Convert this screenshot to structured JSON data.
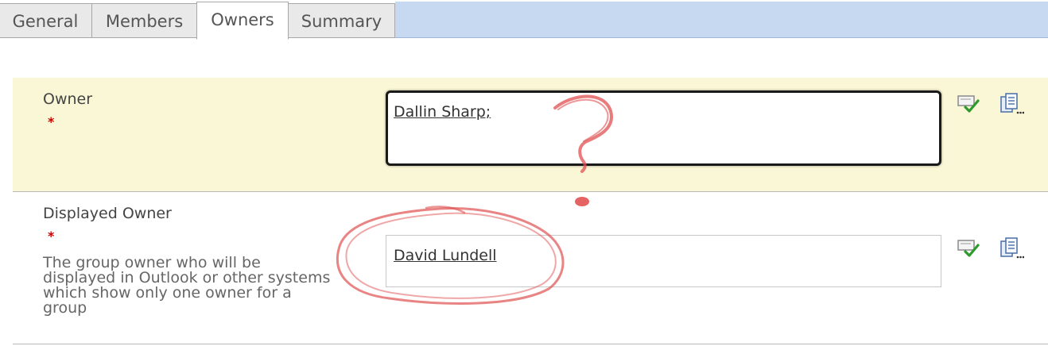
{
  "tabs": [
    {
      "label": "General",
      "active": false
    },
    {
      "label": "Members",
      "active": false
    },
    {
      "label": "Owners",
      "active": true
    },
    {
      "label": "Summary",
      "active": false
    }
  ],
  "fields": {
    "owner": {
      "label": "Owner",
      "required_marker": "*",
      "value": "Dallin Sharp;"
    },
    "displayed_owner": {
      "label": "Displayed Owner",
      "required_marker": "*",
      "description_lines": [
        "The group owner who will be",
        "displayed in Outlook or other systems",
        "which show only one owner for a",
        "group"
      ],
      "value": "David Lundell"
    }
  },
  "icons": {
    "check_names": "check-names-icon",
    "browse": "address-book-icon"
  },
  "colors": {
    "tab_strip": "#c6d9f1",
    "owner_row_bg": "#faf7d6",
    "required": "#cc0000",
    "annotation": "#e05050"
  }
}
